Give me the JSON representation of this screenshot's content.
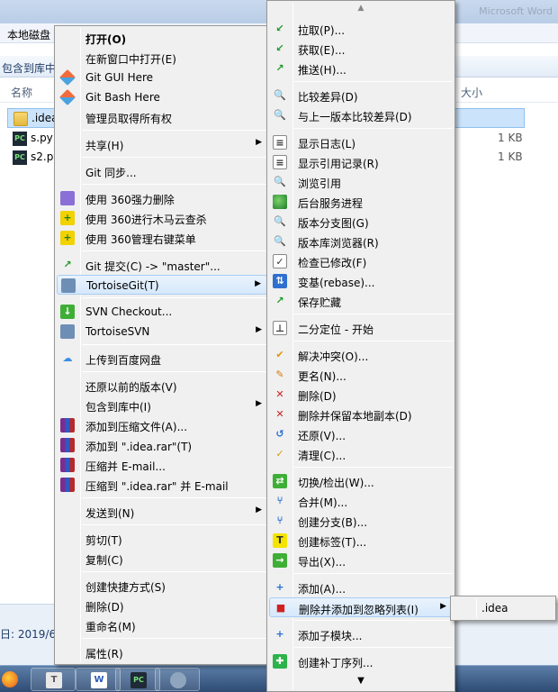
{
  "explorer": {
    "path_crumb": "本地磁盘",
    "toolbar_text": "包含到库中",
    "title_blur": "Microsoft Word",
    "columns": {
      "name": "名称",
      "size": "大小"
    },
    "files": [
      {
        "name": ".idea",
        "size": "",
        "icon": "folder-icon",
        "selected": true
      },
      {
        "name": "s.py",
        "size": "1 KB",
        "icon": "pycharm-file-icon",
        "selected": false
      },
      {
        "name": "s2.py",
        "size": "1 KB",
        "icon": "pycharm-file-icon",
        "selected": false
      }
    ],
    "details_text": "日: 2019/6/2"
  },
  "main_menu": {
    "items": {
      "open": "打开(O)",
      "open_new_window": "在新窗口中打开(E)",
      "git_gui": "Git GUI Here",
      "git_bash": "Git Bash Here",
      "take_ownership": "管理员取得所有权",
      "share": "共享(H)",
      "git_sync": "Git 同步...",
      "del_360": "使用 360强力删除",
      "scan_360": "使用 360进行木马云查杀",
      "manage_360": "使用 360管理右键菜单",
      "git_commit": "Git 提交(C) -> \"master\"...",
      "tortoisegit": "TortoiseGit(T)",
      "svn_checkout": "SVN Checkout...",
      "tortoisesvn": "TortoiseSVN",
      "baidu_upload": "上传到百度网盘",
      "restore": "还原以前的版本(V)",
      "include_library": "包含到库中(I)",
      "add_archive": "添加到压缩文件(A)...",
      "add_rar": "添加到 \".idea.rar\"(T)",
      "compress_email": "压缩并 E-mail...",
      "compress_rar_email": "压缩到 \".idea.rar\" 并 E-mail",
      "send_to": "发送到(N)",
      "cut": "剪切(T)",
      "copy": "复制(C)",
      "create_shortcut": "创建快捷方式(S)",
      "delete": "删除(D)",
      "rename": "重命名(M)",
      "properties": "属性(R)"
    }
  },
  "git_menu": {
    "scroll_up": "▲",
    "scroll_down": "▼",
    "items": {
      "pull": "拉取(P)...",
      "fetch": "获取(E)...",
      "push": "推送(H)...",
      "diff": "比较差异(D)",
      "diff_prev": "与上一版本比较差异(D)",
      "show_log": "显示日志(L)",
      "reflog": "显示引用记录(R)",
      "browse_refs": "浏览引用",
      "daemon": "后台服务进程",
      "rev_graph": "版本分支图(G)",
      "repo_browser": "版本库浏览器(R)",
      "check_mods": "检查已修改(F)",
      "rebase": "变基(rebase)...",
      "stash_save": "保存贮藏",
      "bisect": "二分定位 - 开始",
      "resolve": "解决冲突(O)...",
      "rename": "更名(N)...",
      "delete": "删除(D)",
      "delete_keep": "删除并保留本地副本(D)",
      "revert": "还原(V)...",
      "cleanup": "清理(C)...",
      "switch": "切换/检出(W)...",
      "merge": "合并(M)...",
      "branch": "创建分支(B)...",
      "tag": "创建标签(T)...",
      "export": "导出(X)...",
      "add": "添加(A)...",
      "delete_ignore": "删除并添加到忽略列表(I)",
      "submodule_add": "添加子模块...",
      "create_patch": "创建补丁序列..."
    }
  },
  "ignore_menu": {
    "item": ".idea"
  },
  "taskbar": {
    "buttons": [
      "firefox",
      "text-editor",
      "word",
      "pycharm",
      "tortoise"
    ],
    "word_glyph": "W",
    "pycharm_glyph": "PC",
    "text_glyph": "T"
  }
}
